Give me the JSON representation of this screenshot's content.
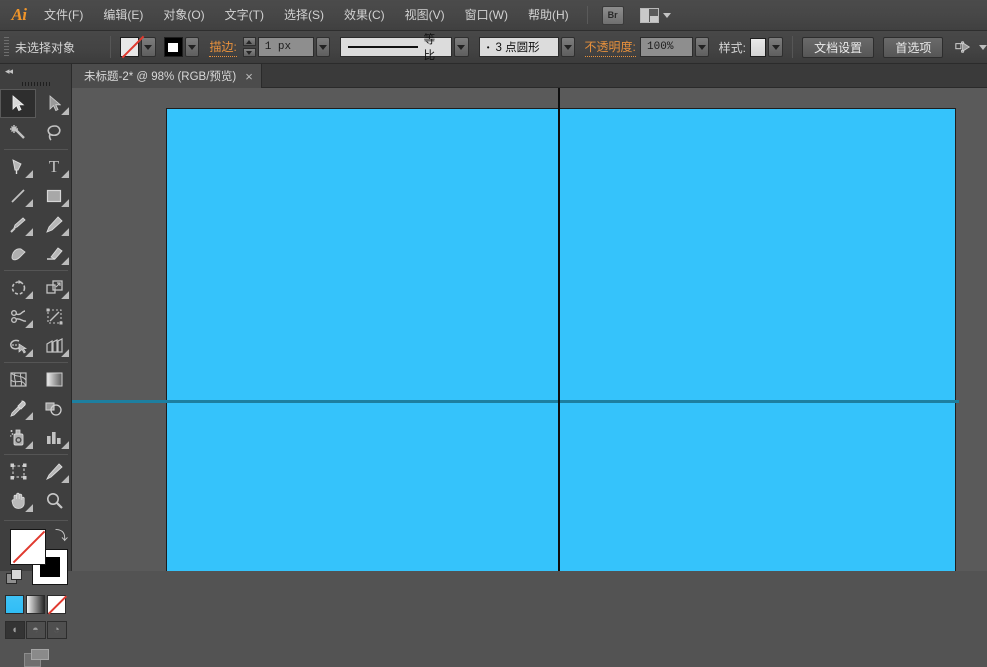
{
  "app": {
    "name": "Adobe Illustrator",
    "logo_text": "Ai",
    "accent_color": "#f0952a"
  },
  "menubar": {
    "items": [
      {
        "label": "文件(F)",
        "name": "menu-file"
      },
      {
        "label": "编辑(E)",
        "name": "menu-edit"
      },
      {
        "label": "对象(O)",
        "name": "menu-object"
      },
      {
        "label": "文字(T)",
        "name": "menu-type"
      },
      {
        "label": "选择(S)",
        "name": "menu-select"
      },
      {
        "label": "效果(C)",
        "name": "menu-effect"
      },
      {
        "label": "视图(V)",
        "name": "menu-view"
      },
      {
        "label": "窗口(W)",
        "name": "menu-window"
      },
      {
        "label": "帮助(H)",
        "name": "menu-help"
      }
    ],
    "bridge_label": "Br",
    "workspace_icon": "workspace-layout-icon"
  },
  "controlbar": {
    "selection_status": "未选择对象",
    "fill_swatch": {
      "label": "fill-none",
      "value": "none"
    },
    "stroke_swatch": {
      "label": "stroke-black",
      "value": "#000000"
    },
    "stroke_label": "描边:",
    "stroke_weight": "1 px",
    "stroke_profile": "等比",
    "brush_definition": "3 点圆形",
    "brush_bullet": "•",
    "opacity_label": "不透明度:",
    "opacity_value": "100%",
    "style_label": "样式:",
    "style_swatch": "default-graphic-style",
    "doc_setup_button": "文档设置",
    "preferences_button": "首选项",
    "align_icon": "align-objects-icon"
  },
  "tabbar": {
    "collapse_icon": "collapse-panel-icon",
    "document": {
      "title": "未标题-2* @ 98% (RGB/预览)",
      "close_label": "×"
    }
  },
  "toolbar": {
    "collapse_icon": "collapse-toolbar-icon",
    "tools": [
      {
        "name": "selection-tool",
        "glyph": "➤",
        "active": true,
        "sub": false
      },
      {
        "name": "direct-selection-tool",
        "glyph": "➤",
        "active": false,
        "sub": true
      },
      {
        "name": "magic-wand-tool",
        "glyph": "✸",
        "active": false,
        "sub": false
      },
      {
        "name": "lasso-tool",
        "glyph": "◠",
        "active": false,
        "sub": false
      },
      {
        "name": "pen-tool",
        "glyph": "✒",
        "active": false,
        "sub": true
      },
      {
        "name": "type-tool",
        "glyph": "T",
        "active": false,
        "sub": true
      },
      {
        "name": "line-segment-tool",
        "glyph": "╱",
        "active": false,
        "sub": true
      },
      {
        "name": "rectangle-tool",
        "glyph": "▢",
        "active": false,
        "sub": true
      },
      {
        "name": "paintbrush-tool",
        "glyph": "🖌",
        "active": false,
        "sub": true
      },
      {
        "name": "pencil-tool",
        "glyph": "✎",
        "active": false,
        "sub": true
      },
      {
        "name": "blob-brush-tool",
        "glyph": "◣",
        "active": false,
        "sub": false
      },
      {
        "name": "eraser-tool",
        "glyph": "▱",
        "active": false,
        "sub": true
      },
      {
        "name": "rotate-tool",
        "glyph": "↻",
        "active": false,
        "sub": true
      },
      {
        "name": "scale-tool",
        "glyph": "⤢",
        "active": false,
        "sub": true
      },
      {
        "name": "width-tool",
        "glyph": "✂",
        "active": false,
        "sub": true
      },
      {
        "name": "free-transform-tool",
        "glyph": "◹",
        "active": false,
        "sub": false
      },
      {
        "name": "shape-builder-tool",
        "glyph": "◉",
        "active": false,
        "sub": true
      },
      {
        "name": "perspective-grid-tool",
        "glyph": "▤",
        "active": false,
        "sub": true
      },
      {
        "name": "mesh-tool",
        "glyph": "▩",
        "active": false,
        "sub": false
      },
      {
        "name": "gradient-tool",
        "glyph": "▦",
        "active": false,
        "sub": false
      },
      {
        "name": "eyedropper-tool",
        "glyph": "⌖",
        "active": false,
        "sub": true
      },
      {
        "name": "blend-tool",
        "glyph": "◐",
        "active": false,
        "sub": false
      },
      {
        "name": "symbol-sprayer-tool",
        "glyph": "⛾",
        "active": false,
        "sub": true
      },
      {
        "name": "column-graph-tool",
        "glyph": "▥",
        "active": false,
        "sub": true
      },
      {
        "name": "artboard-tool",
        "glyph": "⛶",
        "active": false,
        "sub": false
      },
      {
        "name": "slice-tool",
        "glyph": "✐",
        "active": false,
        "sub": true
      },
      {
        "name": "hand-tool",
        "glyph": "✋",
        "active": false,
        "sub": true
      },
      {
        "name": "zoom-tool",
        "glyph": "🔍",
        "active": false,
        "sub": false
      }
    ],
    "fill_stroke": {
      "fill_name": "fill-swatch-none",
      "stroke_name": "stroke-swatch-black",
      "swap_icon": "swap-fill-stroke-icon",
      "default_icon": "default-fill-stroke-icon"
    },
    "color_modes": [
      {
        "name": "color-mode-button",
        "value": "#35c3fb"
      },
      {
        "name": "gradient-mode-button",
        "value": "gradient"
      },
      {
        "name": "none-mode-button",
        "value": "none"
      }
    ],
    "draw_modes": [
      {
        "name": "draw-normal-button",
        "glyph": "◖",
        "selected": true
      },
      {
        "name": "draw-behind-button",
        "glyph": "◓",
        "selected": false
      },
      {
        "name": "draw-inside-button",
        "glyph": "◔",
        "selected": false
      }
    ],
    "screen_mode": {
      "name": "change-screen-mode-button"
    }
  },
  "canvas": {
    "background_color": "#5a5a5a",
    "artwork": {
      "name": "blue-rectangle-artwork",
      "fill_color": "#35c3fb",
      "border_color": "#1e1e1e"
    },
    "guides": [
      {
        "name": "vertical-guide",
        "color": "#0e0e0e",
        "orientation": "vertical"
      },
      {
        "name": "horizontal-guide",
        "color": "#1d7fa0",
        "orientation": "horizontal"
      }
    ]
  }
}
